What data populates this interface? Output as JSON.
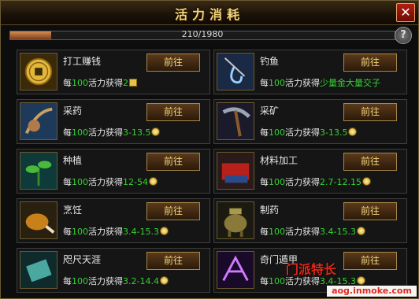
{
  "window": {
    "title": "活力消耗",
    "close_glyph": "✕"
  },
  "progress": {
    "text": "210/1980",
    "value": 210,
    "max": 1980
  },
  "help_glyph": "?",
  "cards": [
    {
      "name": "打工赚钱",
      "button": "前往",
      "reward_pre": "每",
      "reward_num": "100",
      "reward_mid": "活力获得",
      "reward_val": "2",
      "reward_icon": "book-icon",
      "icon": "coin-icon"
    },
    {
      "name": "钓鱼",
      "button": "前往",
      "reward_pre": "每",
      "reward_num": "100",
      "reward_mid": "活力获得",
      "reward_val": "少量金大量交子",
      "reward_icon": "",
      "icon": "fishing-hook-icon"
    },
    {
      "name": "采药",
      "button": "前往",
      "reward_pre": "每",
      "reward_num": "100",
      "reward_mid": "活力获得",
      "reward_val": "3-13.5",
      "reward_icon": "coin-icon",
      "icon": "herb-sickle-icon"
    },
    {
      "name": "采矿",
      "button": "前往",
      "reward_pre": "每",
      "reward_num": "100",
      "reward_mid": "活力获得",
      "reward_val": "3-13.5",
      "reward_icon": "coin-icon",
      "icon": "pickaxe-icon"
    },
    {
      "name": "种植",
      "button": "前往",
      "reward_pre": "每",
      "reward_num": "100",
      "reward_mid": "活力获得",
      "reward_val": "12-54",
      "reward_icon": "coin-icon",
      "icon": "sprout-icon"
    },
    {
      "name": "材料加工",
      "button": "前往",
      "reward_pre": "每",
      "reward_num": "100",
      "reward_mid": "活力获得",
      "reward_val": "2.7-12.15",
      "reward_icon": "coin-icon",
      "icon": "cloth-bundle-icon"
    },
    {
      "name": "烹饪",
      "button": "前往",
      "reward_pre": "每",
      "reward_num": "100",
      "reward_mid": "活力获得",
      "reward_val": "3.4-15.3",
      "reward_icon": "coin-icon",
      "icon": "roast-meat-icon"
    },
    {
      "name": "制药",
      "button": "前往",
      "reward_pre": "每",
      "reward_num": "100",
      "reward_mid": "活力获得",
      "reward_val": "3.4-15.3",
      "reward_icon": "coin-icon",
      "icon": "cauldron-icon"
    },
    {
      "name": "咫尺天涯",
      "button": "前往",
      "reward_pre": "每",
      "reward_num": "100",
      "reward_mid": "活力获得",
      "reward_val": "3.2-14.4",
      "reward_icon": "coin-icon",
      "icon": "scroll-icon"
    },
    {
      "name": "奇门遁甲",
      "button": "前往",
      "reward_pre": "每",
      "reward_num": "100",
      "reward_mid": "活力获得",
      "reward_val": "3.4-15.3",
      "reward_icon": "coin-icon",
      "icon": "magic-rune-icon"
    }
  ],
  "watermark": {
    "line1": "门派特长",
    "line2": "aog.inmoke.com"
  }
}
